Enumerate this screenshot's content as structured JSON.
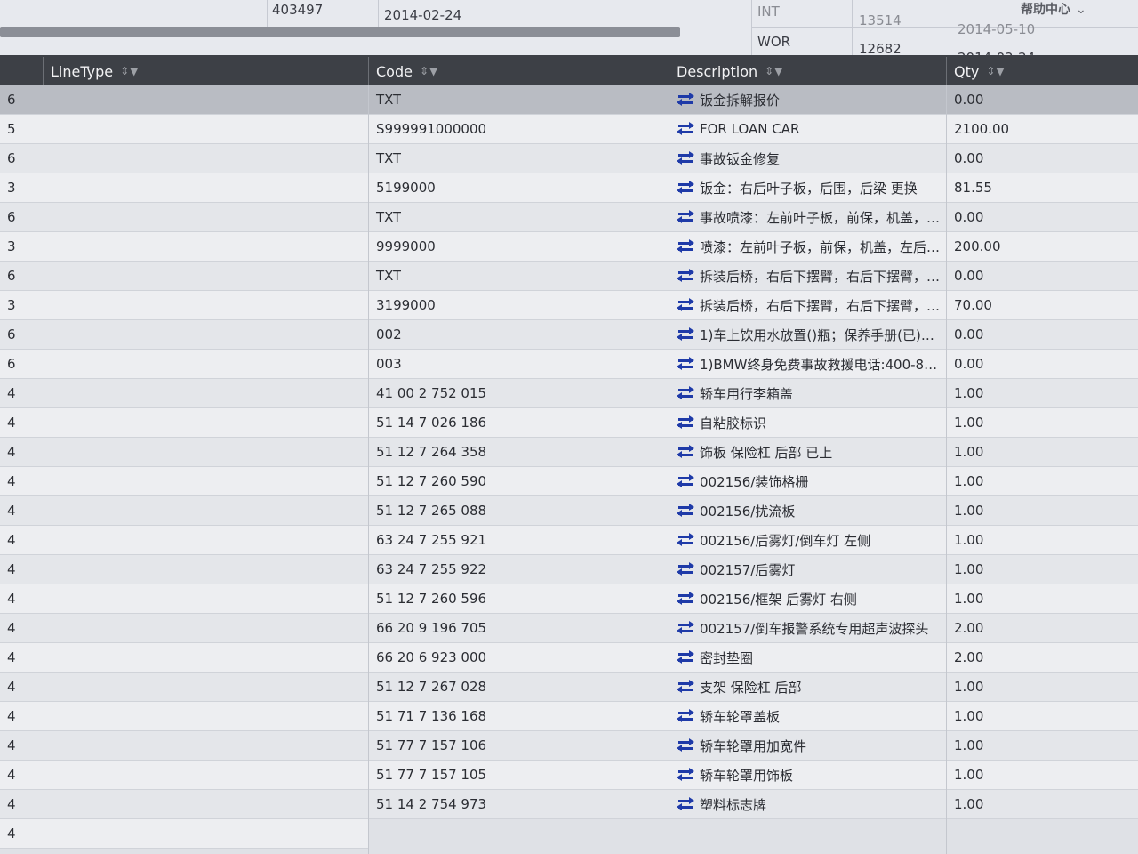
{
  "top_table": {
    "row1": {
      "id": "403497",
      "date": "2014-02-24",
      "type": "INT",
      "num": "13514",
      "date2": "2014-05-10"
    },
    "row2": {
      "type": "WOR",
      "num": "12682",
      "date2": "2014-02-24"
    }
  },
  "help_link": "帮助中心",
  "grid": {
    "headers": {
      "line_type": "LineType",
      "code": "Code",
      "description": "Description",
      "qty": "Qty"
    },
    "line_types": [
      "6",
      "5",
      "6",
      "3",
      "6",
      "3",
      "6",
      "3",
      "6",
      "6",
      "4",
      "4",
      "4",
      "4",
      "4",
      "4",
      "4",
      "4",
      "4",
      "4",
      "4",
      "4",
      "4",
      "4",
      "4",
      "4"
    ],
    "rows": [
      {
        "code": "TXT",
        "description": "钣金拆解报价",
        "qty": "0.00"
      },
      {
        "code": "S999991000000",
        "description": "FOR LOAN CAR",
        "qty": "2100.00"
      },
      {
        "code": "TXT",
        "description": "事故钣金修复",
        "qty": "0.00"
      },
      {
        "code": "5199000",
        "description": "钣金：右后叶子板，后围，后梁 更换",
        "qty": "81.55"
      },
      {
        "code": "TXT",
        "description": "事故喷漆：左前叶子板，前保，机盖，…",
        "qty": "0.00"
      },
      {
        "code": "9999000",
        "description": "喷漆：左前叶子板，前保，机盖，左后…",
        "qty": "200.00"
      },
      {
        "code": "TXT",
        "description": "拆装后桥，右后下摆臂，右后下摆臂，…",
        "qty": "0.00"
      },
      {
        "code": "3199000",
        "description": "拆装后桥，右后下摆臂，右后下摆臂，…",
        "qty": "70.00"
      },
      {
        "code": "002",
        "description": "1)车上饮用水放置()瓶；保养手册(已)盖…",
        "qty": "0.00"
      },
      {
        "code": "003",
        "description": "1)BMW终身免费事故救援电话:400-81…",
        "qty": "0.00"
      },
      {
        "code": "41 00 2 752 015",
        "description": "轿车用行李箱盖",
        "qty": "1.00"
      },
      {
        "code": "51 14 7 026 186",
        "description": "自粘胶标识",
        "qty": "1.00"
      },
      {
        "code": "51 12 7 264 358",
        "description": "饰板 保险杠 后部 已上",
        "qty": "1.00"
      },
      {
        "code": "51 12 7 260 590",
        "description": "002156/装饰格栅",
        "qty": "1.00"
      },
      {
        "code": "51 12 7 265 088",
        "description": "002156/扰流板",
        "qty": "1.00"
      },
      {
        "code": "63 24 7 255 921",
        "description": "002156/后雾灯/倒车灯 左侧",
        "qty": "1.00"
      },
      {
        "code": "63 24 7 255 922",
        "description": "002157/后雾灯",
        "qty": "1.00"
      },
      {
        "code": "51 12 7 260 596",
        "description": "002156/框架 后雾灯 右侧",
        "qty": "1.00"
      },
      {
        "code": "66 20 9 196 705",
        "description": "002157/倒车报警系统专用超声波探头",
        "qty": "2.00"
      },
      {
        "code": "66 20 6 923 000",
        "description": "密封垫圈",
        "qty": "2.00"
      },
      {
        "code": "51 12 7 267 028",
        "description": "支架 保险杠 后部",
        "qty": "1.00"
      },
      {
        "code": "51 71 7 136 168",
        "description": "轿车轮罩盖板",
        "qty": "1.00"
      },
      {
        "code": "51 77 7 157 106",
        "description": "轿车轮罩用加宽件",
        "qty": "1.00"
      },
      {
        "code": "51 77 7 157 105",
        "description": "轿车轮罩用饰板",
        "qty": "1.00"
      },
      {
        "code": "51 14 2 754 973",
        "description": "塑料标志牌",
        "qty": "1.00"
      }
    ]
  }
}
